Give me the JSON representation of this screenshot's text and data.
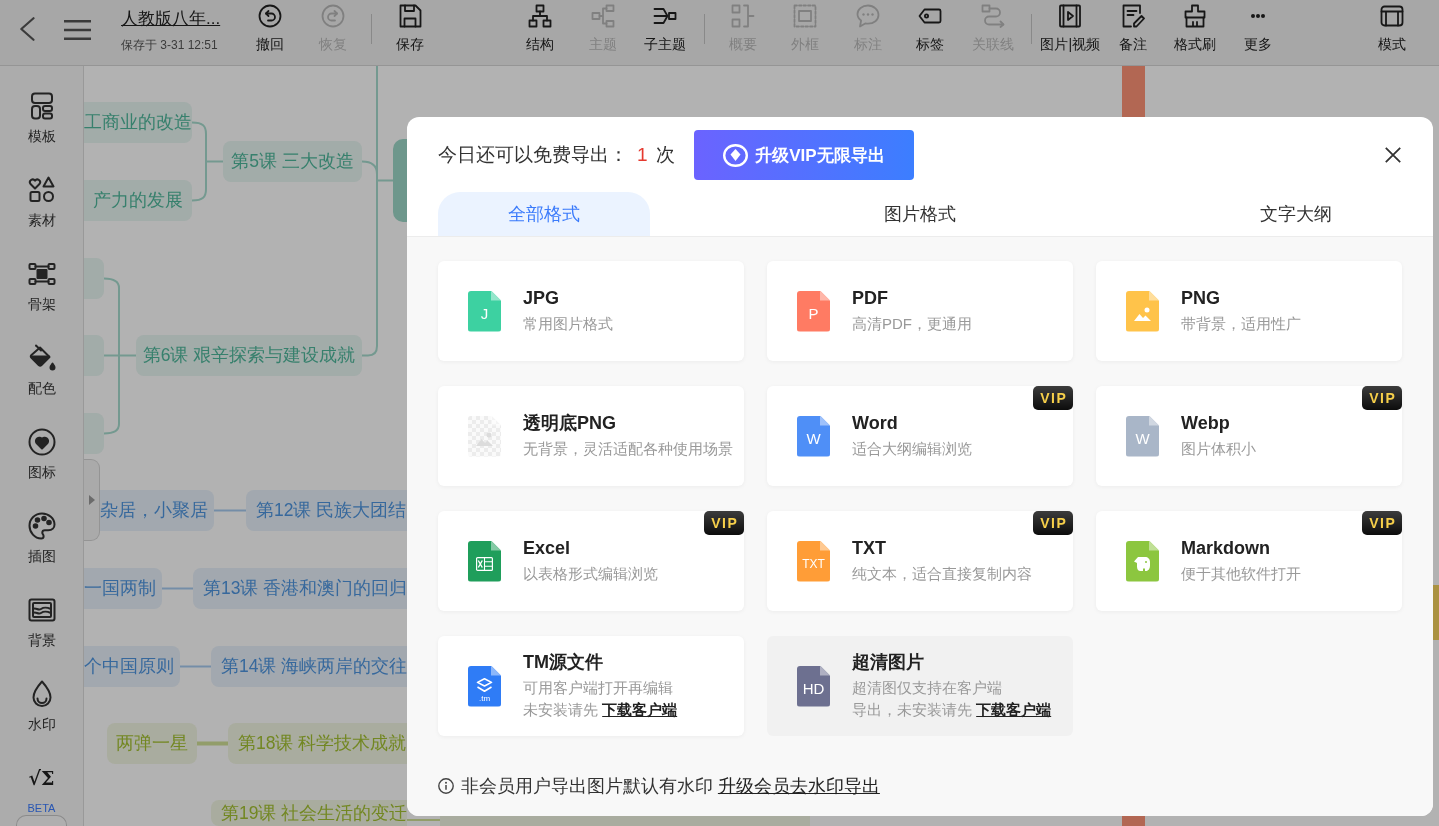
{
  "toolbar": {
    "title": "人教版八年...",
    "saved_at": "保存于 3-31 12:51",
    "groups": [
      {
        "tools": [
          {
            "kind": "undo",
            "label": "撤回",
            "disabled": false
          },
          {
            "kind": "redo",
            "label": "恢复",
            "disabled": true
          }
        ]
      },
      {
        "tools": [
          {
            "kind": "save",
            "label": "保存",
            "disabled": false
          }
        ]
      },
      {
        "tools": [
          {
            "kind": "structure",
            "label": "结构",
            "disabled": false
          },
          {
            "kind": "topic",
            "label": "主题",
            "disabled": true
          },
          {
            "kind": "subtopic",
            "label": "子主题",
            "disabled": false
          }
        ]
      },
      {
        "tools": [
          {
            "kind": "summary",
            "label": "概要",
            "disabled": true
          },
          {
            "kind": "frame",
            "label": "外框",
            "disabled": true
          },
          {
            "kind": "callout",
            "label": "标注",
            "disabled": true
          },
          {
            "kind": "tag",
            "label": "标签",
            "disabled": false
          },
          {
            "kind": "relation",
            "label": "关联线",
            "disabled": true
          }
        ]
      },
      {
        "tools": [
          {
            "kind": "media",
            "label": "图片|视频",
            "disabled": false
          },
          {
            "kind": "note",
            "label": "备注",
            "disabled": false
          },
          {
            "kind": "brush",
            "label": "格式刷",
            "disabled": false
          },
          {
            "kind": "more",
            "label": "更多",
            "disabled": false
          }
        ]
      },
      {
        "tools": [
          {
            "kind": "mode",
            "label": "模式",
            "disabled": false
          }
        ]
      }
    ]
  },
  "sidebar": {
    "items": [
      {
        "kind": "template",
        "label": "模板"
      },
      {
        "kind": "material",
        "label": "素材"
      },
      {
        "kind": "skeleton",
        "label": "骨架"
      },
      {
        "kind": "color",
        "label": "配色"
      },
      {
        "kind": "icon",
        "label": "图标"
      },
      {
        "kind": "illustration",
        "label": "插图"
      },
      {
        "kind": "background",
        "label": "背景"
      },
      {
        "kind": "watermark",
        "label": "水印"
      },
      {
        "kind": "formula",
        "symbol": "√Σ",
        "badge": "BETA"
      }
    ]
  },
  "mind_map": {
    "branches": [
      {
        "nodes": [
          "工商业的改造",
          "产力的发展",
          "第5课 三大改造",
          "第6课 艰辛探索与建设成就"
        ]
      },
      {
        "nodes": [
          "杂居，小聚居",
          "第12课 民族大团结",
          "一国两制",
          "第13课 香港和澳门的回归",
          "个中国原则",
          "第14课 海峡两岸的交往"
        ]
      },
      {
        "nodes": [
          "两弹一星",
          "第18课 科学技术成就",
          "第19课 社会生活的变迁"
        ]
      }
    ]
  },
  "export_dialog": {
    "quota_label": "今日还可以免费导出：",
    "quota_count": "1",
    "quota_unit": "次",
    "upgrade_button": "升级VIP无限导出",
    "tabs": [
      {
        "label": "全部格式",
        "selected": true
      },
      {
        "label": "图片格式",
        "selected": false
      },
      {
        "label": "文字大纲",
        "selected": false
      }
    ],
    "formats": [
      {
        "kind": "letter",
        "icon_text": "J",
        "color": "#3dd1a1",
        "title": "JPG",
        "description": "常用图片格式",
        "disabled": false
      },
      {
        "kind": "letter",
        "icon_text": "P",
        "color": "#ff7b63",
        "title": "PDF",
        "description": "高清PDF，更通用",
        "disabled": false
      },
      {
        "kind": "image",
        "color": "#ffc34a",
        "title": "PNG",
        "description": "带背景，适用性广",
        "disabled": false
      },
      {
        "kind": "transparent",
        "color": "#ececec",
        "title": "透明底PNG",
        "description": "无背景，灵活适配各种使用场景",
        "disabled": false
      },
      {
        "kind": "letter",
        "icon_text": "W",
        "color": "#4f8ff7",
        "title": "Word",
        "description": "适合大纲编辑浏览",
        "badge": "VIP",
        "disabled": false
      },
      {
        "kind": "letter",
        "icon_text": "W",
        "color": "#a9b6c8",
        "title": "Webp",
        "description": "图片体积小",
        "badge": "VIP",
        "disabled": false
      },
      {
        "kind": "spreadsheet",
        "color": "#1f9e5b",
        "title": "Excel",
        "description": "以表格形式编辑浏览",
        "badge": "VIP",
        "disabled": false
      },
      {
        "kind": "letter",
        "icon_text": "TXT",
        "color": "#ff9d37",
        "title": "TXT",
        "description": "纯文本，适合直接复制内容",
        "badge": "VIP",
        "disabled": false
      },
      {
        "kind": "elephant",
        "color": "#8cc63f",
        "title": "Markdown",
        "description": "便于其他软件打开",
        "badge": "VIP",
        "disabled": false
      },
      {
        "kind": "logo",
        "icon_text": ".tm",
        "color": "#2f7cf6",
        "title": "TM源文件",
        "description": "可用客户端打开再编辑",
        "note": "未安装请先",
        "link": "下载客户端",
        "disabled": false
      },
      {
        "kind": "letter",
        "icon_text": "HD",
        "color": "#6d7090",
        "title": "超清图片",
        "description": "超清图仅支持在客户端",
        "note": "导出，未安装请先",
        "link": "下载客户端",
        "disabled": true
      }
    ],
    "notice": "非会员用户导出图片默认有水印",
    "notice_link": "升级会员去水印导出"
  }
}
